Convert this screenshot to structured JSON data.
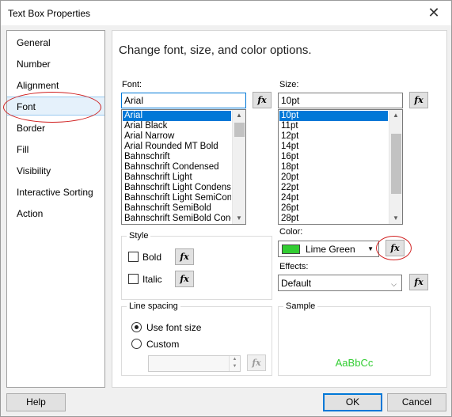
{
  "window": {
    "title": "Text Box Properties",
    "close_glyph": "✕"
  },
  "sidebar": {
    "items": [
      {
        "label": "General"
      },
      {
        "label": "Number"
      },
      {
        "label": "Alignment"
      },
      {
        "label": "Font",
        "selected": true
      },
      {
        "label": "Border"
      },
      {
        "label": "Fill"
      },
      {
        "label": "Visibility"
      },
      {
        "label": "Interactive Sorting"
      },
      {
        "label": "Action"
      }
    ]
  },
  "main": {
    "heading": "Change font, size, and color options.",
    "fx_label": "fx",
    "font": {
      "label": "Font:",
      "value": "Arial",
      "options": [
        "Arial",
        "Arial Black",
        "Arial Narrow",
        "Arial Rounded MT Bold",
        "Bahnschrift",
        "Bahnschrift Condensed",
        "Bahnschrift Light",
        "Bahnschrift Light Condensed",
        "Bahnschrift Light SemiCondensed",
        "Bahnschrift SemiBold",
        "Bahnschrift SemiBold Condensed"
      ],
      "selected_index": 0
    },
    "size": {
      "label": "Size:",
      "value": "10pt",
      "options": [
        "10pt",
        "11pt",
        "12pt",
        "14pt",
        "16pt",
        "18pt",
        "20pt",
        "22pt",
        "24pt",
        "26pt",
        "28pt"
      ],
      "selected_index": 0
    },
    "style": {
      "title": "Style",
      "bold_label": "Bold",
      "bold_checked": false,
      "italic_label": "Italic",
      "italic_checked": false
    },
    "color": {
      "label": "Color:",
      "value": "Lime Green",
      "swatch": "#32cd32"
    },
    "effects": {
      "label": "Effects:",
      "value": "Default"
    },
    "line_spacing": {
      "title": "Line spacing",
      "options": [
        {
          "label": "Use font size",
          "selected": true
        },
        {
          "label": "Custom",
          "selected": false
        }
      ],
      "custom_value": ""
    },
    "sample": {
      "title": "Sample",
      "text": "AaBbCc",
      "color": "#32cd32"
    }
  },
  "footer": {
    "help_label": "Help",
    "ok_label": "OK",
    "cancel_label": "Cancel"
  },
  "colors": {
    "accent": "#0078d7",
    "annotation": "#d02020"
  }
}
